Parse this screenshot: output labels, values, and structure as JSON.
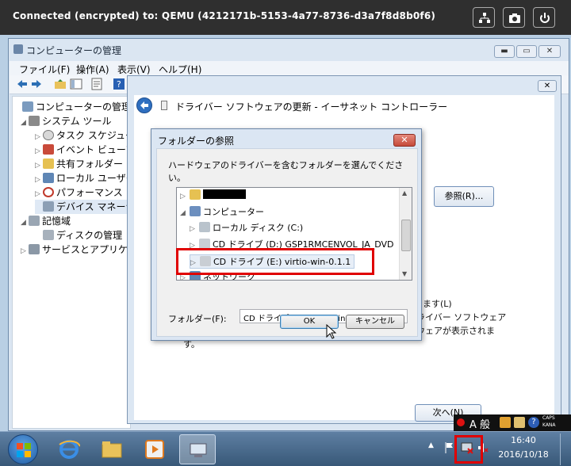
{
  "console": {
    "title": "Connected (encrypted) to: QEMU (4212171b-5153-4a77-8736-d3a7f8d8b0f6)"
  },
  "mmc": {
    "title": "コンピューターの管理",
    "menu": [
      "ファイル(F)",
      "操作(A)",
      "表示(V)",
      "ヘルプ(H)"
    ],
    "tree": [
      {
        "label": "コンピューターの管理 (ロ",
        "exp": ""
      },
      {
        "label": "システム ツール",
        "exp": "◢"
      },
      {
        "label": "タスク スケジュー",
        "exp": "▷"
      },
      {
        "label": "イベント ビューア",
        "exp": "▷"
      },
      {
        "label": "共有フォルダー",
        "exp": "▷"
      },
      {
        "label": "ローカル ユーザー",
        "exp": "▷"
      },
      {
        "label": "パフォーマンス",
        "exp": "▷"
      },
      {
        "label": "デバイス マネージ",
        "exp": ""
      },
      {
        "label": "記憶域",
        "exp": "◢"
      },
      {
        "label": "ディスクの管理",
        "exp": ""
      },
      {
        "label": "サービスとアプリケー",
        "exp": "▷"
      }
    ]
  },
  "wizard": {
    "title": "ドライバー ソフトウェアの更新 - イーサネット コントローラー",
    "browse_label": "参照(R)...",
    "text_lines": [
      "ます(L)",
      "ライバー ソフトウェア",
      "ウェアが表示されま",
      "す。"
    ],
    "next_label": "次へ(N)"
  },
  "folder_dialog": {
    "title": "フォルダーの参照",
    "prompt": "ハードウェアのドライバーを含むフォルダーを選んでください。",
    "tree": [
      {
        "label": "",
        "redacted": true,
        "exp": "▷"
      },
      {
        "label": "コンピューター",
        "exp": "◢"
      },
      {
        "label": "ローカル ディスク (C:)",
        "exp": "▷"
      },
      {
        "label": "CD ドライブ (D:) GSP1RMCENVOL_JA_DVD",
        "exp": "▷"
      },
      {
        "label": "CD ドライブ (E:) virtio-win-0.1.1",
        "exp": "▷"
      },
      {
        "label": "ネットワーク",
        "exp": "▷"
      }
    ],
    "folder_label": "フォルダー(F):",
    "folder_value": "CD ドライブ (E:) virtio-win-0.1.1",
    "ok_label": "OK",
    "cancel_label": "キャンセル"
  },
  "taskbar": {
    "time": "16:40",
    "date": "2016/10/18",
    "lang": "A 般",
    "caps": "CAPS",
    "kana": "KANA"
  }
}
